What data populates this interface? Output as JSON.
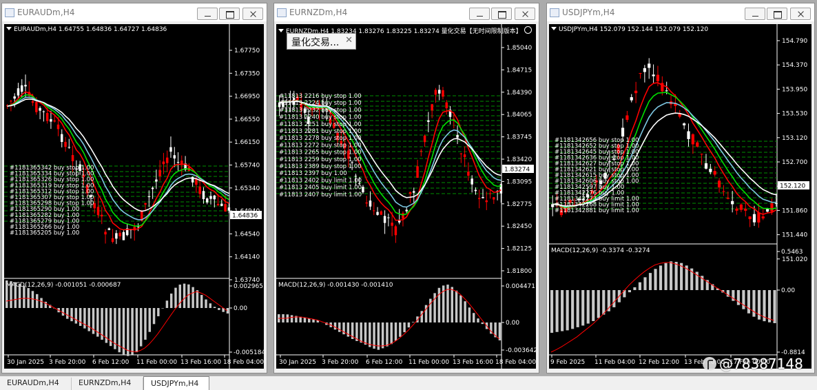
{
  "windows": [
    {
      "title": "EURAUDm,H4",
      "chart_header": "EURAUDm,H4  1.64755 1.64836 1.64727 1.64836",
      "price_ticks": [
        "1.67750",
        "1.67350",
        "1.66950",
        "1.66550",
        "1.66150",
        "1.65740",
        "1.65340",
        "1.64940",
        "1.64540",
        "1.64140",
        "1.63740"
      ],
      "current_price": "1.64836",
      "macd_header": "MACD(12,26,9) -0.001051 -0.000687",
      "macd_ticks": [
        "0.002965",
        "0.00",
        "-0.005184"
      ],
      "time_labels": [
        "30 Jan 2025",
        "3 Feb 20:00",
        "6 Feb 12:00",
        "11 Feb 00:00",
        "13 Feb 16:00",
        "18 Feb 04:00"
      ],
      "orders": [
        "#1181365342 buy stop 1.00",
        "#1181365334 buy stop 1.00",
        "#1181365326 buy stop 1.00",
        "#1181365319 buy stop 1.00",
        "#1181365312 buy stop 1.00",
        "#1181365307 buy stop 1.00",
        "#1181365298 buy stop 1.00",
        "#1181365290 buy 1.00",
        "#1181365282 buy 1.00",
        "#1181365279 buy 1.00",
        "#1181365266 buy 1.00",
        "#1181365205 buy 1.00"
      ]
    },
    {
      "title": "EURNZDm,H4",
      "chart_header": "EURNZDm,H4  1.83234 1.83276 1.83225 1.83274",
      "header_extra": "量化交易【无时间限制版本】",
      "price_ticks": [
        "1.85040",
        "1.84715",
        "1.84390",
        "1.84065",
        "1.83745",
        "1.83420",
        "1.83095",
        "1.82775",
        "1.82450",
        "1.82125",
        "1.81800"
      ],
      "current_price": "1.83274",
      "macd_header": "MACD(12,26,9) -0.001430 -0.001410",
      "macd_ticks": [
        "0.004471",
        "0.00",
        "-0.003642"
      ],
      "time_labels": [
        "30 Jan 2025",
        "3 Feb 20:00",
        "6 Feb 12:00",
        "11 Feb 00:00",
        "13 Feb 16:00",
        "18 Feb 04:00"
      ],
      "orders": [
        "#11813 2216 buy stop 1.00",
        "#11813 2224 buy stop 1.00",
        "#11813 2232 buy stop 1.00",
        "#11813 2240 buy stop 1.00",
        "#11813 2251 buy stop 1.00",
        "#11813 2281 buy stop 1.00",
        "#11813 2278 buy stop 1.00",
        "#11813 2272 buy stop 1.00",
        "#11813 2265 buy stop 1.00",
        "#11813 2259 buy stop 1.00",
        "#11813 2389 buy stop 1.00",
        "#11813 2397 buy 1.00",
        "#11813 2402 buy limit 1.00",
        "#11813 2405 buy limit 1.00",
        "#11813 2407 buy limit 1.00"
      ]
    },
    {
      "title": "USDJPYm,H4",
      "chart_header": "USDJPYm,H4  152.079 152.144 152.079 152.120",
      "price_ticks": [
        "154.790",
        "154.370",
        "153.950",
        "153.530",
        "153.120",
        "152.700",
        "152.280",
        "151.860",
        "151.440",
        "151.020"
      ],
      "current_price": "152.120",
      "macd_header": "MACD(12,26,9) -0.3374 -0.3274",
      "macd_ticks": [
        "0.5463",
        "0.00",
        "-0.8814"
      ],
      "time_labels": [
        "9 Feb 2025",
        "11 Feb 04:00",
        "12 Feb 12:00",
        "13 Feb 20:00",
        "17 Feb 00:00"
      ],
      "orders": [
        "#1181342656 buy stop 1.00",
        "#1181342652 buy stop 1.00",
        "#1181342645 buy stop 1.00",
        "#1181342636 buy stop 1.00",
        "#1181342627 buy stop 1.00",
        "#1181342621 buy stop 1.00",
        "#1181342615 buy stop 1.00",
        "#1181342606 buy stop 1.00",
        "#1181342597 buy 1.00",
        "#1181342276 buy 1.00",
        "#1181342273 buy limit 1.00",
        "#1181342268 buy limit 1.00",
        "#1181342881 buy limit 1.00"
      ]
    }
  ],
  "popup": {
    "title": "量化交易...",
    "close": "✕"
  },
  "tabs": [
    "EURAUDm,H4",
    "EURNZDm,H4",
    "USDJPYm,H4"
  ],
  "watermark": "@78387148",
  "colors": {
    "bull": "#ffffff",
    "bear": "#ff0000",
    "grid": "#00c000",
    "ma_green": "#00e000",
    "ma_red": "#ff0000",
    "ma_cyan": "#7ec8e3",
    "ma_white": "#ffffff",
    "macd_hist": "#c8c8c8",
    "macd_signal": "#ff0000"
  }
}
